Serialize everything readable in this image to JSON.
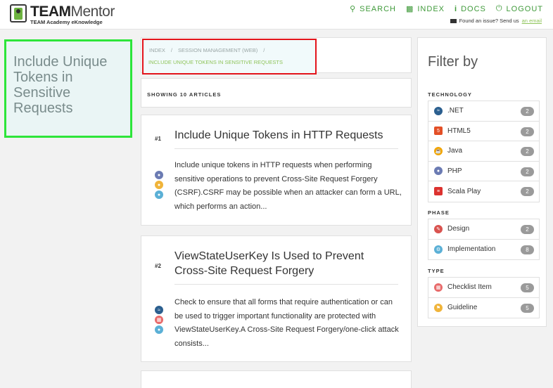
{
  "header": {
    "logo": {
      "title_bold": "TEAM",
      "title_rest": "Mentor",
      "subtitle": "TEAM Academy eKnowledge"
    },
    "nav": [
      {
        "label": "SEARCH",
        "icon": "search-icon"
      },
      {
        "label": "INDEX",
        "icon": "folder-icon"
      },
      {
        "label": "DOCS",
        "icon": "info-icon"
      },
      {
        "label": "LOGOUT",
        "icon": "power-icon"
      }
    ],
    "issue_text": "Found an issue? Send us",
    "issue_link": "an email"
  },
  "title_panel": {
    "title": "Include Unique Tokens in Sensitive Requests"
  },
  "breadcrumb": {
    "items": [
      "INDEX",
      "/",
      "SESSION MANAGEMENT (WEB)",
      "/"
    ],
    "current": "INCLUDE UNIQUE TOKENS IN SENSITIVE REQUESTS"
  },
  "showing": "SHOWING 10 ARTICLES",
  "articles": [
    {
      "number": "#1",
      "title": "Include Unique Tokens in HTTP Requests",
      "summary": "Include unique tokens in HTTP requests when performing sensitive operations to prevent Cross-Site Request Forgery (CSRF).CSRF may be possible when an attacker can form a URL, which performs an action..."
    },
    {
      "number": "#2",
      "title": "ViewStateUserKey Is Used to Prevent Cross-Site Request Forgery",
      "summary": "Check to ensure that all forms that require authentication or can be used to trigger important functionality are protected with ViewStateUserKey.A Cross-Site Request Forgery/one-click attack consists..."
    }
  ],
  "filter": {
    "title": "Filter by",
    "groups": [
      {
        "label": "TECHNOLOGY",
        "items": [
          {
            "label": ".NET",
            "count": "2",
            "icon": "dotnet-icon"
          },
          {
            "label": "HTML5",
            "count": "2",
            "icon": "html5-icon"
          },
          {
            "label": "Java",
            "count": "2",
            "icon": "java-icon"
          },
          {
            "label": "PHP",
            "count": "2",
            "icon": "php-icon"
          },
          {
            "label": "Scala Play",
            "count": "2",
            "icon": "scala-icon"
          }
        ]
      },
      {
        "label": "PHASE",
        "items": [
          {
            "label": "Design",
            "count": "2",
            "icon": "design-icon"
          },
          {
            "label": "Implementation",
            "count": "8",
            "icon": "implementation-icon"
          }
        ]
      },
      {
        "label": "TYPE",
        "items": [
          {
            "label": "Checklist Item",
            "count": "5",
            "icon": "checklist-icon"
          },
          {
            "label": "Guideline",
            "count": "5",
            "icon": "guideline-icon"
          }
        ]
      }
    ]
  },
  "colors": {
    "accent": "#3f9a3a",
    "highlight_green": "#2ee53a",
    "highlight_red": "#e3141b"
  }
}
